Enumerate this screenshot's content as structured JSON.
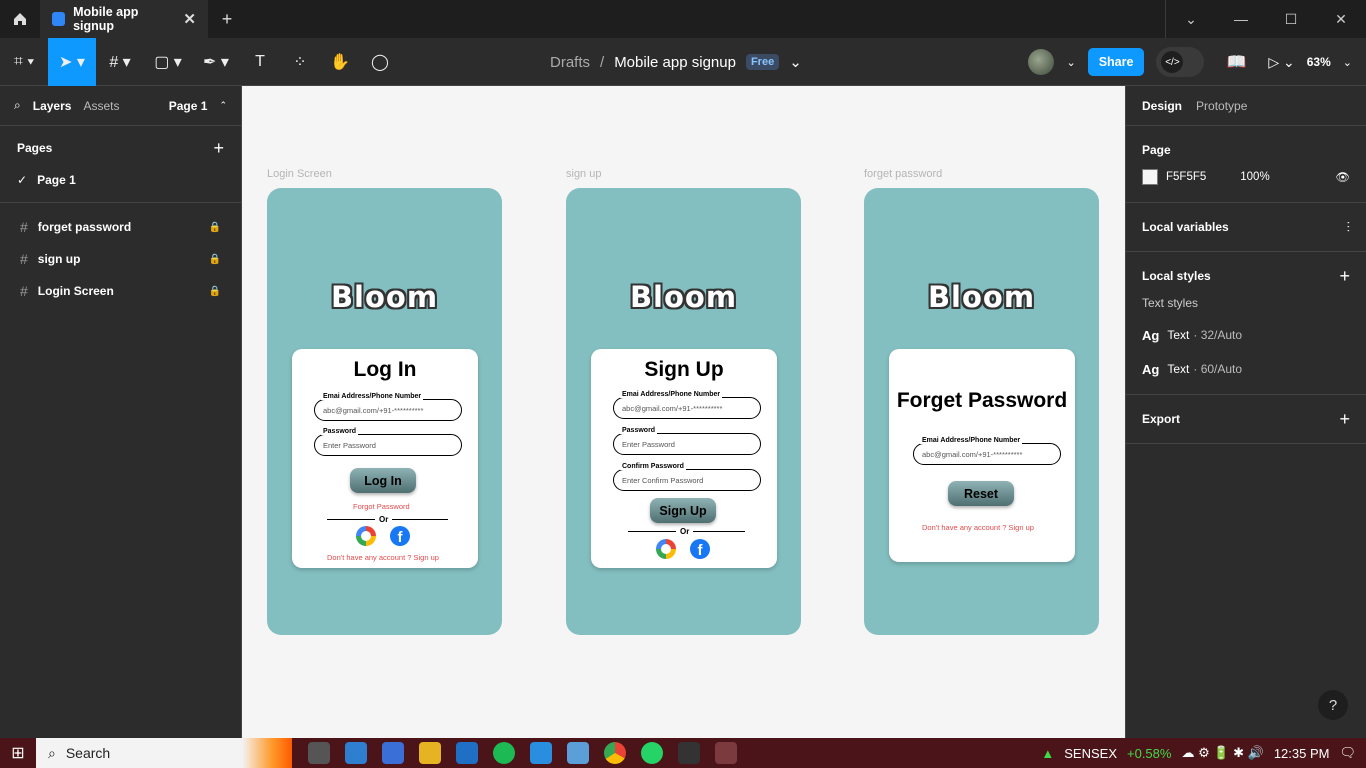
{
  "tabbar": {
    "tab_title": "Mobile app signup",
    "new_tab": "+"
  },
  "toolbar": {
    "breadcrumb_parent": "Drafts",
    "file_name": "Mobile app signup",
    "plan_badge": "Free",
    "share_label": "Share",
    "zoom": "63%"
  },
  "left": {
    "tab_layers": "Layers",
    "tab_assets": "Assets",
    "page_selector": "Page 1",
    "pages_title": "Pages",
    "pages": [
      "Page 1"
    ],
    "layers": [
      "forget password",
      "sign up",
      "Login Screen"
    ]
  },
  "canvas": {
    "frames": [
      {
        "label": "Login Screen",
        "logo": "Bloom",
        "title": "Log In",
        "fields": [
          {
            "label": "Emai Address/Phone Number",
            "value": "abc@gmail.com/+91-**********"
          },
          {
            "label": "Password",
            "value": "Enter Password"
          }
        ],
        "button": "Log In",
        "forgot": "Forgot Password",
        "or": "Or",
        "signup_link": "Don't have any account ? Sign up"
      },
      {
        "label": "sign up",
        "logo": "Bloom",
        "title": "Sign Up",
        "fields": [
          {
            "label": "Emai Address/Phone Number",
            "value": "abc@gmail.com/+91-**********"
          },
          {
            "label": "Password",
            "value": "Enter Password"
          },
          {
            "label": "Confirm Password",
            "value": "Enter Confirm Password"
          }
        ],
        "button": "Sign Up",
        "or": "Or"
      },
      {
        "label": "forget password",
        "logo": "Bloom",
        "title": "Forget Password",
        "fields": [
          {
            "label": "Emai Address/Phone Number",
            "value": "abc@gmail.com/+91-**********"
          }
        ],
        "button": "Reset",
        "signup_link": "Don't have any account ? Sign up"
      }
    ]
  },
  "right": {
    "tab_design": "Design",
    "tab_prototype": "Prototype",
    "page_title": "Page",
    "page_color": "F5F5F5",
    "page_opacity": "100%",
    "local_variables": "Local variables",
    "local_styles": "Local styles",
    "text_styles": "Text styles",
    "styles": [
      {
        "ag": "Ag",
        "name": "Text",
        "spec": "· 32/Auto"
      },
      {
        "ag": "Ag",
        "name": "Text",
        "spec": "· 60/Auto"
      }
    ],
    "export": "Export"
  },
  "help": "?",
  "taskbar": {
    "search": "Search",
    "ticker": "SENSEX",
    "change": "+0.58%",
    "time": "12:35 PM"
  },
  "colors": {
    "accent": "#0d99ff",
    "frame": "#83bfc0",
    "link": "#e34b4b",
    "taskbar": "#4a1418"
  }
}
